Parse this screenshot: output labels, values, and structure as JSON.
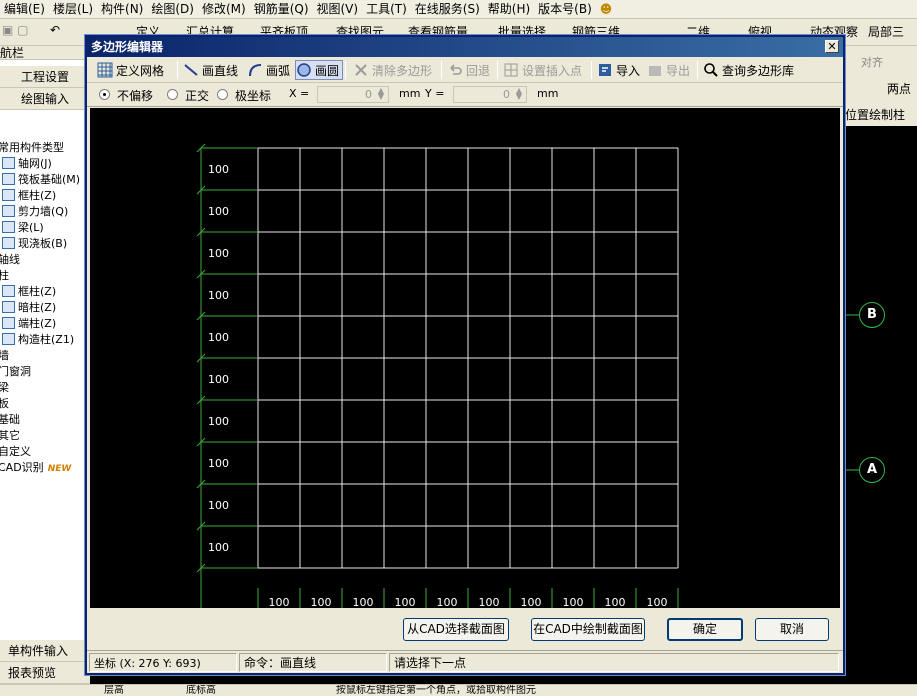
{
  "app": {
    "menu": [
      "编辑(E)",
      "楼层(L)",
      "构件(N)",
      "绘图(D)",
      "修改(M)",
      "钢筋量(Q)",
      "视图(V)",
      "工具(T)",
      "在线服务(S)",
      "帮助(H)",
      "版本号(B)"
    ],
    "toolbar_items": [
      "定义",
      "汇总计算",
      "平齐板顶",
      "查找图元",
      "查看钢筋量",
      "批量选择",
      "钢筋三维",
      "二维",
      "俯视",
      "动态观察",
      "局部三"
    ],
    "right_items": [
      "对齐",
      "两点",
      "位置绘制柱"
    ],
    "axis_labels": [
      "B",
      "A"
    ]
  },
  "left_panel": {
    "header_partial": "航栏",
    "project_settings": "工程设置",
    "drawing_input": "绘图输入",
    "tree": [
      {
        "label": "常用构件类型",
        "indent": 0,
        "icon": false
      },
      {
        "label": "轴网(J)",
        "indent": 1,
        "icon": true
      },
      {
        "label": "筏板基础(M)",
        "indent": 1,
        "icon": true
      },
      {
        "label": "框柱(Z)",
        "indent": 1,
        "icon": true
      },
      {
        "label": "剪力墙(Q)",
        "indent": 1,
        "icon": true
      },
      {
        "label": "梁(L)",
        "indent": 1,
        "icon": true
      },
      {
        "label": "现浇板(B)",
        "indent": 1,
        "icon": true
      },
      {
        "label": "轴线",
        "indent": 0,
        "icon": false
      },
      {
        "label": "柱",
        "indent": 0,
        "icon": false
      },
      {
        "label": "框柱(Z)",
        "indent": 1,
        "icon": true
      },
      {
        "label": "暗柱(Z)",
        "indent": 1,
        "icon": true
      },
      {
        "label": "端柱(Z)",
        "indent": 1,
        "icon": true
      },
      {
        "label": "构造柱(Z1)",
        "indent": 1,
        "icon": true
      },
      {
        "label": "墙",
        "indent": 0,
        "icon": false
      },
      {
        "label": "门窗洞",
        "indent": 0,
        "icon": false
      },
      {
        "label": "梁",
        "indent": 0,
        "icon": false
      },
      {
        "label": "板",
        "indent": 0,
        "icon": false
      },
      {
        "label": "基础",
        "indent": 0,
        "icon": false
      },
      {
        "label": "其它",
        "indent": 0,
        "icon": false
      },
      {
        "label": "自定义",
        "indent": 0,
        "icon": false
      },
      {
        "label": "CAD识别",
        "indent": 0,
        "icon": false,
        "badge": "NEW"
      }
    ],
    "single_input": "单构件输入",
    "report_preview": "报表预览"
  },
  "bottom_bar": {
    "seg1": "层高",
    "seg2": "底标高",
    "seg3": "按鼠标左键指定第一个角点，或拾取构件图元"
  },
  "dialog": {
    "title": "多边形编辑器",
    "close_glyph": "✕",
    "toolbar": {
      "define_grid": "定义网格",
      "draw_line": "画直线",
      "draw_arc": "画弧",
      "draw_circle": "画圆",
      "clear_polygon": "清除多边形",
      "undo": "回退",
      "set_insert_point": "设置插入点",
      "import": "导入",
      "export": "导出",
      "query_library": "查询多边形库"
    },
    "options": {
      "no_offset": "不偏移",
      "orthogonal": "正交",
      "polar": "极坐标",
      "x_label": "X =",
      "x_value": "0",
      "x_unit": "mm",
      "y_label": "Y =",
      "y_value": "0",
      "y_unit": "mm",
      "selected": "no_offset"
    },
    "grid": {
      "row_labels": [
        "100",
        "100",
        "100",
        "100",
        "100",
        "100",
        "100",
        "100",
        "100",
        "100"
      ],
      "col_labels": [
        "100",
        "100",
        "100",
        "100",
        "100",
        "100",
        "100",
        "100",
        "100",
        "100"
      ],
      "line_color": "#e8e8e8",
      "dim_color": "#3cab3c"
    },
    "buttons": {
      "select_from_cad": "从CAD选择截面图",
      "draw_in_cad": "在CAD中绘制截面图",
      "ok": "确定",
      "cancel": "取消"
    },
    "status": {
      "coords": "坐标 (X: 276 Y: 693)",
      "command": "命令：画直线",
      "prompt": "请选择下一点"
    }
  }
}
